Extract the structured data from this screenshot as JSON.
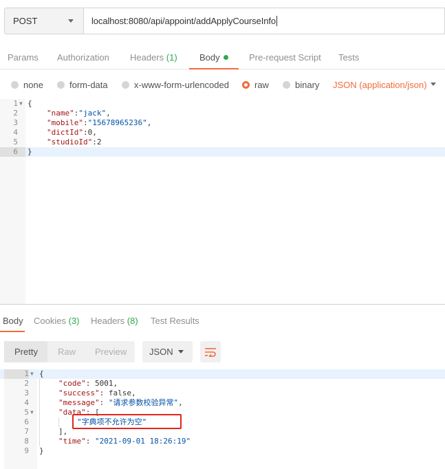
{
  "request": {
    "method": "POST",
    "url": "localhost:8080/api/appoint/addApplyCourseInfo"
  },
  "request_tabs": [
    {
      "label": "Params"
    },
    {
      "label": "Authorization"
    },
    {
      "label": "Headers",
      "count": "(1)"
    },
    {
      "label": "Body"
    },
    {
      "label": "Pre-request Script"
    },
    {
      "label": "Tests"
    }
  ],
  "body_types": [
    {
      "label": "none",
      "selected": false
    },
    {
      "label": "form-data",
      "selected": false
    },
    {
      "label": "x-www-form-urlencoded",
      "selected": false
    },
    {
      "label": "raw",
      "selected": true
    },
    {
      "label": "binary",
      "selected": false
    }
  ],
  "raw_format": "JSON (application/json)",
  "request_body": {
    "line_numbers": [
      "1",
      "2",
      "3",
      "4",
      "5",
      "6"
    ],
    "open_brace": "{",
    "fields": [
      {
        "key": "\"name\"",
        "value": "\"jack\"",
        "sep": ","
      },
      {
        "key": "\"mobile\"",
        "value": "\"15678965236\"",
        "sep": ","
      },
      {
        "key": "\"dictId\"",
        "value": "0",
        "sep": ","
      },
      {
        "key": "\"studioId\"",
        "value": "2",
        "sep": ""
      }
    ],
    "close_brace": "}"
  },
  "response_tabs": [
    {
      "label": "Body"
    },
    {
      "label": "Cookies",
      "count": "(3)"
    },
    {
      "label": "Headers",
      "count": "(8)"
    },
    {
      "label": "Test Results"
    }
  ],
  "view_modes": [
    {
      "label": "Pretty",
      "selected": true
    },
    {
      "label": "Raw",
      "selected": false
    },
    {
      "label": "Preview",
      "selected": false
    }
  ],
  "response_format": "JSON",
  "response_body": {
    "line_numbers": [
      "1",
      "2",
      "3",
      "4",
      "5",
      "6",
      "7",
      "8",
      "9"
    ],
    "open_brace": "{",
    "code_key": "\"code\"",
    "code_value": "5001",
    "success_key": "\"success\"",
    "success_value": "false",
    "message_key": "\"message\"",
    "message_value": "\"请求参数校验异常\"",
    "data_key": "\"data\"",
    "data_open": "[",
    "data_item": "\"字典项不允许为空\"",
    "data_close": "],",
    "time_key": "\"time\"",
    "time_value": "\"2021-09-01 18:26:19\"",
    "close_brace": "}"
  },
  "colors": {
    "accent": "#f26b3a",
    "count_green": "#2fa84f",
    "json_key": "#a31515",
    "json_string": "#0451a5",
    "highlight_box": "#e0241b"
  },
  "icons": {
    "method_dropdown": "chevron-down-icon",
    "format_dropdown": "chevron-down-icon",
    "wrap_button": "wrap-lines-icon",
    "fold_markers": "fold-arrow-icon"
  }
}
